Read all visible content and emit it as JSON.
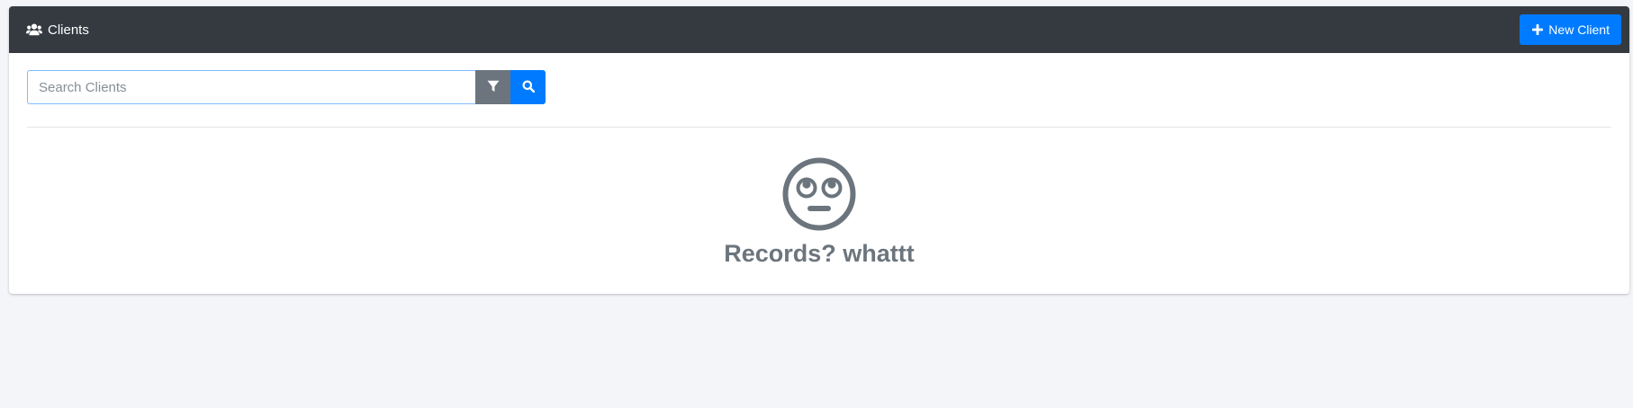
{
  "header": {
    "title": "Clients",
    "title_icon": "users-icon",
    "new_button_label": "New Client",
    "new_button_icon": "plus-icon"
  },
  "search": {
    "placeholder": "Search Clients",
    "value": "",
    "filter_icon": "filter-icon",
    "search_icon": "search-icon"
  },
  "empty_state": {
    "icon": "rolling-eyes-face-icon",
    "message": "Records? whattt"
  },
  "colors": {
    "header_bg": "#343a40",
    "primary": "#007bff",
    "secondary": "#6c757d",
    "page_bg": "#f4f5f9"
  }
}
